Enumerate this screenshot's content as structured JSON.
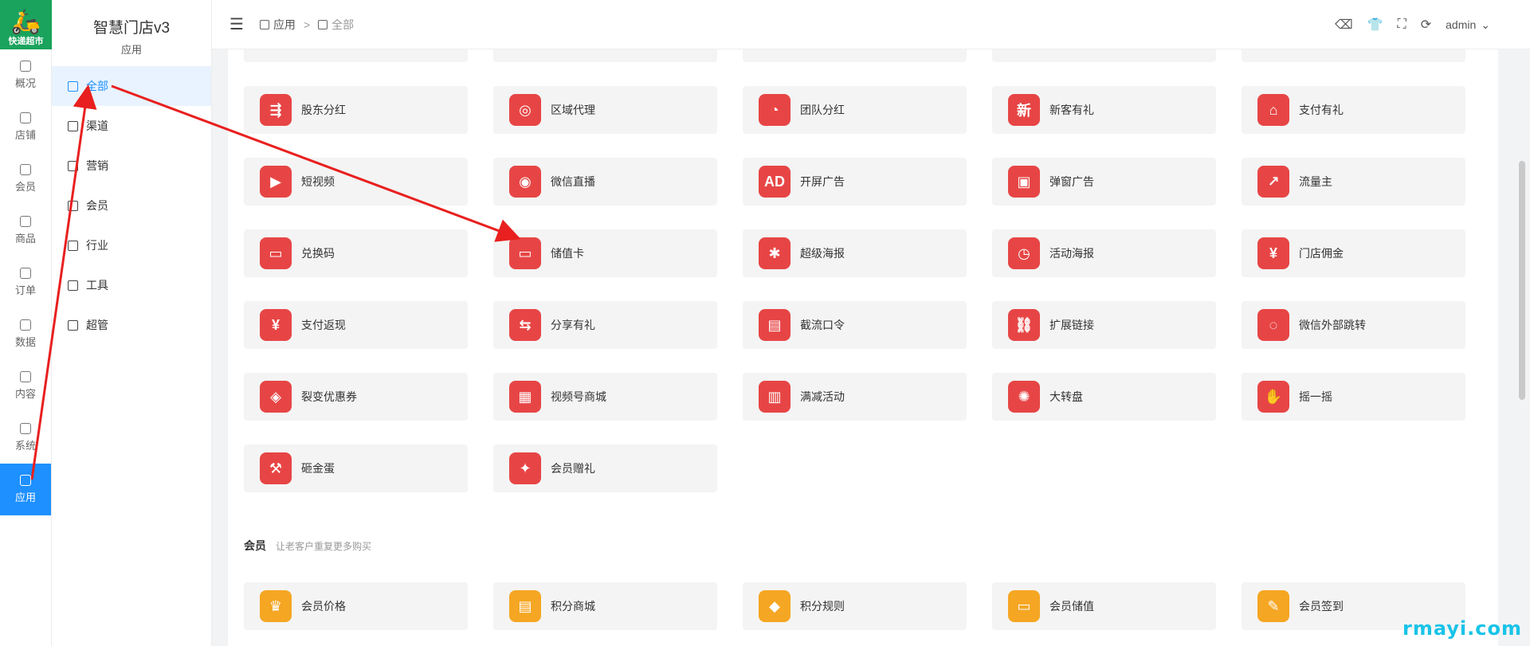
{
  "logo": {
    "text": "快递超市"
  },
  "rail": [
    {
      "label": "概况",
      "icon": "dashboard-icon"
    },
    {
      "label": "店铺",
      "icon": "store-icon"
    },
    {
      "label": "会员",
      "icon": "user-icon"
    },
    {
      "label": "商品",
      "icon": "box-icon"
    },
    {
      "label": "订单",
      "icon": "clipboard-icon"
    },
    {
      "label": "数据",
      "icon": "chart-icon"
    },
    {
      "label": "内容",
      "icon": "folder-icon"
    },
    {
      "label": "系统",
      "icon": "gear-icon"
    },
    {
      "label": "应用",
      "icon": "cube-icon",
      "active": true
    }
  ],
  "submenu": {
    "title": "智慧门店v3",
    "subtitle": "应用",
    "items": [
      {
        "label": "全部",
        "icon": "cube-icon",
        "active": true
      },
      {
        "label": "渠道",
        "icon": "channel-icon"
      },
      {
        "label": "营销",
        "icon": "image-icon"
      },
      {
        "label": "会员",
        "icon": "user-icon"
      },
      {
        "label": "行业",
        "icon": "briefcase-icon"
      },
      {
        "label": "工具",
        "icon": "wrench-icon"
      },
      {
        "label": "超管",
        "icon": "admin-icon"
      }
    ]
  },
  "topbar": {
    "menu_icon": "☰",
    "breadcrumb": [
      "应用",
      "全部"
    ],
    "separator": ">",
    "user": "admin"
  },
  "apps": [
    {
      "label": "股东分红",
      "glyph": "⇶"
    },
    {
      "label": "区域代理",
      "glyph": "◎"
    },
    {
      "label": "团队分红",
      "glyph": "◔"
    },
    {
      "label": "新客有礼",
      "glyph": "新"
    },
    {
      "label": "支付有礼",
      "glyph": "⌂"
    },
    {
      "label": "短视频",
      "glyph": "▶"
    },
    {
      "label": "微信直播",
      "glyph": "◉"
    },
    {
      "label": "开屏广告",
      "glyph": "AD"
    },
    {
      "label": "弹窗广告",
      "glyph": "▣"
    },
    {
      "label": "流量主",
      "glyph": "↗"
    },
    {
      "label": "兑换码",
      "glyph": "▭"
    },
    {
      "label": "储值卡",
      "glyph": "▭"
    },
    {
      "label": "超级海报",
      "glyph": "✱"
    },
    {
      "label": "活动海报",
      "glyph": "◷"
    },
    {
      "label": "门店佣金",
      "glyph": "¥"
    },
    {
      "label": "支付返现",
      "glyph": "¥"
    },
    {
      "label": "分享有礼",
      "glyph": "⇆"
    },
    {
      "label": "截流口令",
      "glyph": "▤"
    },
    {
      "label": "扩展链接",
      "glyph": "⛓"
    },
    {
      "label": "微信外部跳转",
      "glyph": "◌"
    },
    {
      "label": "裂变优惠券",
      "glyph": "◈"
    },
    {
      "label": "视频号商城",
      "glyph": "▦"
    },
    {
      "label": "满减活动",
      "glyph": "▥"
    },
    {
      "label": "大转盘",
      "glyph": "✺"
    },
    {
      "label": "摇一摇",
      "glyph": "✋"
    },
    {
      "label": "砸金蛋",
      "glyph": "⚒"
    },
    {
      "label": "会员赠礼",
      "glyph": "✦"
    }
  ],
  "member_section": {
    "title": "会员",
    "desc": "让老客户重复更多购买",
    "apps": [
      {
        "label": "会员价格",
        "glyph": "♛"
      },
      {
        "label": "积分商城",
        "glyph": "▤"
      },
      {
        "label": "积分规则",
        "glyph": "◆"
      },
      {
        "label": "会员储值",
        "glyph": "▭"
      },
      {
        "label": "会员签到",
        "glyph": "✎"
      }
    ]
  },
  "watermark": "rmayi.com",
  "colors": {
    "accent": "#1e90ff",
    "app_red": "#e74545",
    "app_orange": "#f5a623",
    "arrow": "#e8201f"
  }
}
